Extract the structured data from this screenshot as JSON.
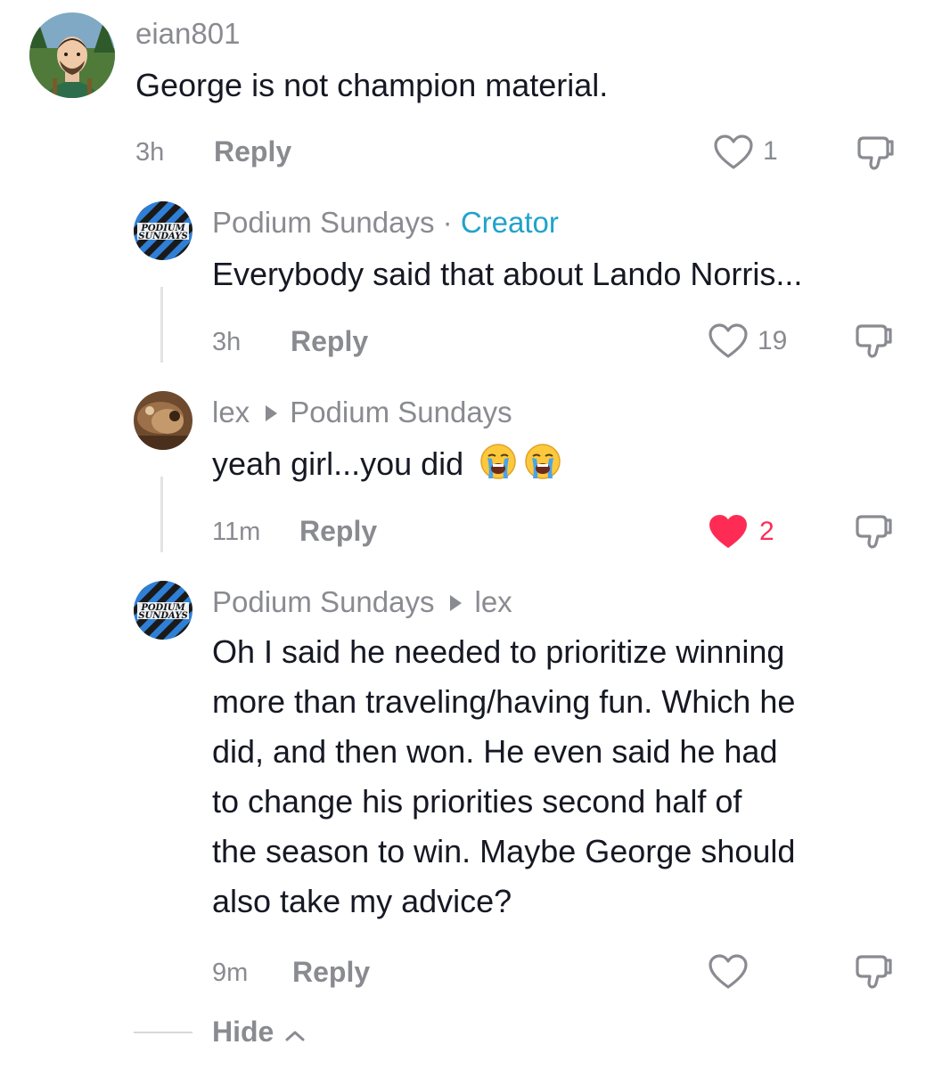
{
  "comments": [
    {
      "username": "eian801",
      "text": "George is not champion material.",
      "time": "3h",
      "reply_label": "Reply",
      "likes": "1",
      "liked": false
    },
    {
      "username": "Podium Sundays",
      "badge_sep": " · ",
      "badge": "Creator",
      "text": "Everybody said that about Lando Norris...",
      "time": "3h",
      "reply_label": "Reply",
      "likes": "19",
      "liked": false,
      "avatar_text": [
        "PODIUM",
        "SUNDAYS"
      ]
    },
    {
      "username": "lex",
      "reply_to": "Podium Sundays",
      "text": "yeah girl...you did",
      "emojis": [
        "loudly-crying-face",
        "loudly-crying-face"
      ],
      "time": "11m",
      "reply_label": "Reply",
      "likes": "2",
      "liked": true
    },
    {
      "username": "Podium Sundays",
      "reply_to": "lex",
      "text_lines": [
        "Oh I said he needed to prioritize winning",
        "more than traveling/having fun. Which he",
        "did, and then won. He even said he had",
        "to change his priorities second half of",
        "the season to win. Maybe George should",
        "also take my advice?"
      ],
      "time": "9m",
      "reply_label": "Reply",
      "likes": "",
      "liked": false,
      "avatar_text": [
        "PODIUM",
        "SUNDAYS"
      ]
    }
  ],
  "hide_label": "Hide",
  "colors": {
    "text": "#161823",
    "muted": "#8a8b91",
    "creator": "#20a3c9",
    "liked": "#fe2c55"
  },
  "icons": [
    "heart-icon",
    "dislike-icon",
    "chevron-up-icon",
    "reply-arrow-icon"
  ]
}
